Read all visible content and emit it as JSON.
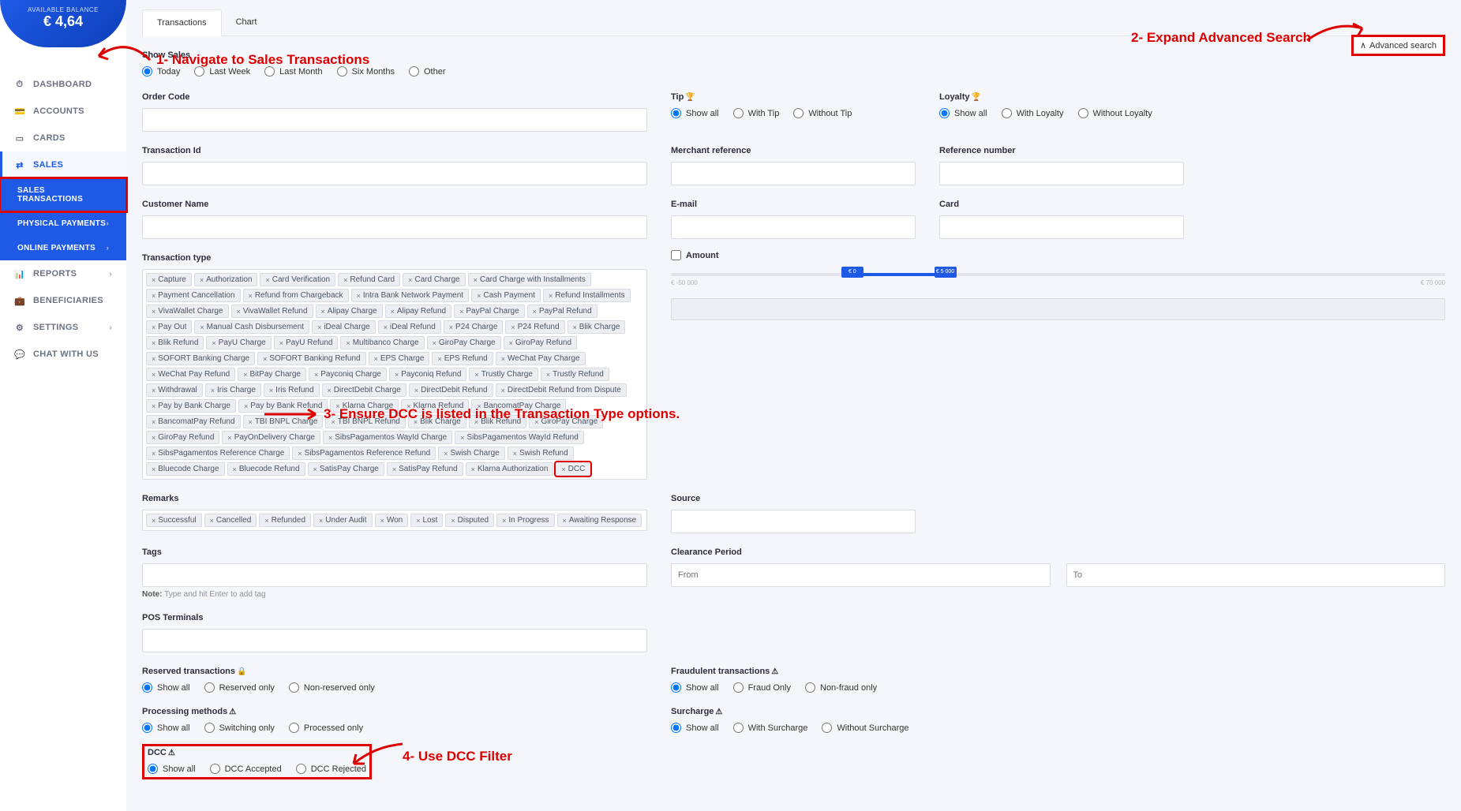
{
  "balance": {
    "label": "AVAILABLE BALANCE",
    "value": "€ 4,64"
  },
  "nav": {
    "dashboard": "DASHBOARD",
    "accounts": "ACCOUNTS",
    "cards": "CARDS",
    "sales": "SALES",
    "reports": "REPORTS",
    "beneficiaries": "BENEFICIARIES",
    "settings": "SETTINGS",
    "chat": "CHAT WITH US"
  },
  "subnav": {
    "salesTransactions": "SALES TRANSACTIONS",
    "physicalPayments": "PHYSICAL PAYMENTS",
    "onlinePayments": "ONLINE PAYMENTS"
  },
  "tabs": {
    "transactions": "Transactions",
    "chart": "Chart"
  },
  "advancedSearch": "Advanced search",
  "annotations": {
    "a1": "1- Navigate to Sales Transactions",
    "a2": "2- Expand Advanced Search",
    "a3": "3- Ensure DCC is listed in the Transaction Type options.",
    "a4": "4- Use DCC Filter"
  },
  "labels": {
    "showSales": "Show Sales",
    "orderCode": "Order Code",
    "transactionId": "Transaction Id",
    "customerName": "Customer Name",
    "transactionType": "Transaction type",
    "remarks": "Remarks",
    "tags": "Tags",
    "tagsNote": "Type and hit Enter to add tag",
    "note": "Note:",
    "posTerminals": "POS Terminals",
    "reserved": "Reserved transactions",
    "processing": "Processing methods",
    "dcc": "DCC",
    "tip": "Tip",
    "loyalty": "Loyalty",
    "merchantRef": "Merchant reference",
    "refNumber": "Reference number",
    "email": "E-mail",
    "card": "Card",
    "amount": "Amount",
    "source": "Source",
    "clearance": "Clearance Period",
    "from": "From",
    "to": "To",
    "fraudulent": "Fraudulent transactions",
    "surcharge": "Surcharge"
  },
  "showSalesOptions": [
    "Today",
    "Last Week",
    "Last Month",
    "Six Months",
    "Other"
  ],
  "tipOptions": [
    "Show all",
    "With Tip",
    "Without Tip"
  ],
  "loyaltyOptions": [
    "Show all",
    "With Loyalty",
    "Without Loyalty"
  ],
  "reservedOptions": [
    "Show all",
    "Reserved only",
    "Non-reserved only"
  ],
  "processingOptions": [
    "Show all",
    "Switching only",
    "Processed only"
  ],
  "dccOptions": [
    "Show all",
    "DCC Accepted",
    "DCC Rejected"
  ],
  "fraudOptions": [
    "Show all",
    "Fraud Only",
    "Non-fraud only"
  ],
  "surchargeOptions": [
    "Show all",
    "With Surcharge",
    "Without Surcharge"
  ],
  "amountSlider": {
    "min": "€ -50 000",
    "h1": "€ 0",
    "h2": "€ 5 000",
    "max": "€ 70 000"
  },
  "transactionTypes": [
    "Capture",
    "Authorization",
    "Card Verification",
    "Refund Card",
    "Card Charge",
    "Card Charge with Installments",
    "Payment Cancellation",
    "Refund from Chargeback",
    "Intra Bank Network Payment",
    "Cash Payment",
    "Refund Installments",
    "VivaWallet Charge",
    "VivaWallet Refund",
    "Alipay Charge",
    "Alipay Refund",
    "PayPal Charge",
    "PayPal Refund",
    "Pay Out",
    "Manual Cash Disbursement",
    "iDeal Charge",
    "iDeal Refund",
    "P24 Charge",
    "P24 Refund",
    "Blik Charge",
    "Blik Refund",
    "PayU Charge",
    "PayU Refund",
    "Multibanco Charge",
    "GiroPay Charge",
    "GiroPay Refund",
    "SOFORT Banking Charge",
    "SOFORT Banking Refund",
    "EPS Charge",
    "EPS Refund",
    "WeChat Pay Charge",
    "WeChat Pay Refund",
    "BitPay Charge",
    "Payconiq Charge",
    "Payconiq Refund",
    "Trustly Charge",
    "Trustly Refund",
    "Withdrawal",
    "Iris Charge",
    "Iris Refund",
    "DirectDebit Charge",
    "DirectDebit Refund",
    "DirectDebit Refund from Dispute",
    "Pay by Bank Charge",
    "Pay by Bank Refund",
    "Klarna Charge",
    "Klarna Refund",
    "BancomatPay Charge",
    "BancomatPay Refund",
    "TBI BNPL Charge",
    "TBI BNPL Refund",
    "Blik Charge",
    "Blik Refund",
    "GiroPay Charge",
    "GiroPay Refund",
    "PayOnDelivery Charge",
    "SibsPagamentos WayId Charge",
    "SibsPagamentos WayId Refund",
    "SibsPagamentos Reference Charge",
    "SibsPagamentos Reference Refund",
    "Swish Charge",
    "Swish Refund",
    "Bluecode Charge",
    "Bluecode Refund",
    "SatisPay Charge",
    "SatisPay Refund",
    "Klarna Authorization",
    "DCC"
  ],
  "remarksTags": [
    "Successful",
    "Cancelled",
    "Refunded",
    "Under Audit",
    "Won",
    "Lost",
    "Disputed",
    "In Progress",
    "Awaiting Response"
  ]
}
